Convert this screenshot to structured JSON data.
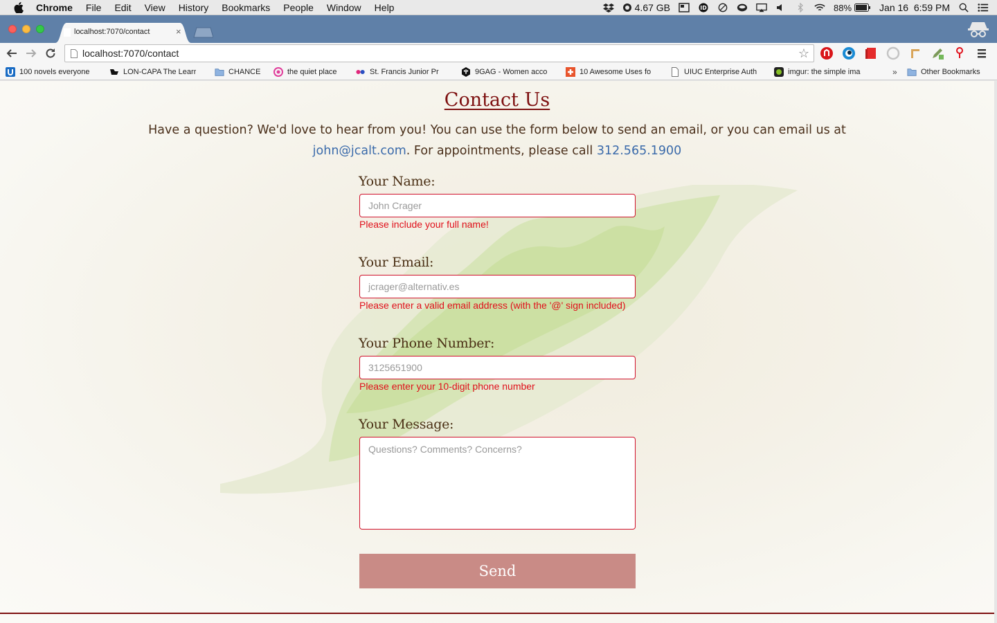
{
  "menubar": {
    "app_name": "Chrome",
    "menus": [
      "File",
      "Edit",
      "View",
      "History",
      "Bookmarks",
      "People",
      "Window",
      "Help"
    ],
    "memory": "4.67 GB",
    "battery": "88%",
    "datetime": "Jan 16  6:59 PM"
  },
  "browser": {
    "tab_title": "localhost:7070/contact",
    "tab_close": "×",
    "url": "localhost:7070/contact",
    "bookmarks": [
      {
        "label": "100 novels everyone",
        "icon": "u-icon"
      },
      {
        "label": "LON-CAPA The Learr",
        "icon": "loncapa-icon"
      },
      {
        "label": "CHANCE",
        "icon": "folder-icon"
      },
      {
        "label": "the quiet place",
        "icon": "circle-logo-icon"
      },
      {
        "label": "St. Francis Junior Pr",
        "icon": "dots-icon"
      },
      {
        "label": "9GAG - Women acco",
        "icon": "9gag-icon"
      },
      {
        "label": "10 Awesome Uses fo",
        "icon": "plus-icon"
      },
      {
        "label": "UIUC Enterprise Auth",
        "icon": "page-icon"
      },
      {
        "label": "imgur: the simple ima",
        "icon": "imgur-icon"
      }
    ],
    "bookmarks_overflow": "»",
    "other_bookmarks": "Other Bookmarks"
  },
  "page": {
    "title": "Contact Us",
    "intro_text": "Have a question? We'd love to hear from you! You can use the form below to send an email, or you can email us at",
    "email_link": "john@jcalt.com",
    "intro_mid": ". For appointments, please call ",
    "phone_link": "312.565.1900",
    "form": {
      "name_label": "Your Name:",
      "name_placeholder": "John Crager",
      "name_error": "Please include your full name!",
      "email_label": "Your Email:",
      "email_placeholder": "jcrager@alternativ.es",
      "email_error": "Please enter a valid email address (with the '@' sign included)",
      "phone_label": "Your Phone Number:",
      "phone_placeholder": "3125651900",
      "phone_error": "Please enter your 10-digit phone number",
      "message_label": "Your Message:",
      "message_placeholder": "Questions? Comments? Concerns?",
      "send_label": "Send"
    }
  },
  "colors": {
    "title": "#7d0f0f",
    "link": "#3a6aaa",
    "error": "#e0101b",
    "send_button": "#c98b86",
    "input_border": "#d0112b"
  }
}
